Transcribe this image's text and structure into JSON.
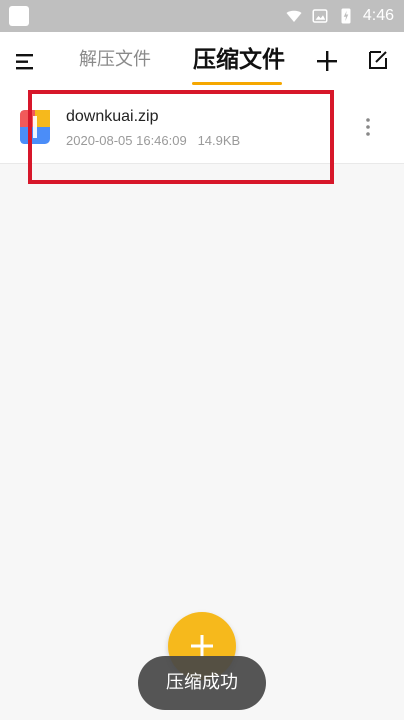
{
  "status_bar": {
    "time": "4:46",
    "icons": [
      "wifi-icon",
      "photo-icon",
      "battery-icon"
    ]
  },
  "app_bar": {
    "tabs": [
      {
        "label": "解压文件",
        "selected": false
      },
      {
        "label": "压缩文件",
        "selected": true
      }
    ],
    "accent_color": "#f5a700"
  },
  "file_list": [
    {
      "name": "downkuai.zip",
      "date": "2020-08-05 16:46:09",
      "size": "14.9KB"
    }
  ],
  "toast": {
    "text": "压缩成功"
  },
  "colors": {
    "status_bar": "#bfbfbf",
    "background": "#f7f7f7",
    "fab": "#f6b91c",
    "highlight": "#d7172a"
  }
}
